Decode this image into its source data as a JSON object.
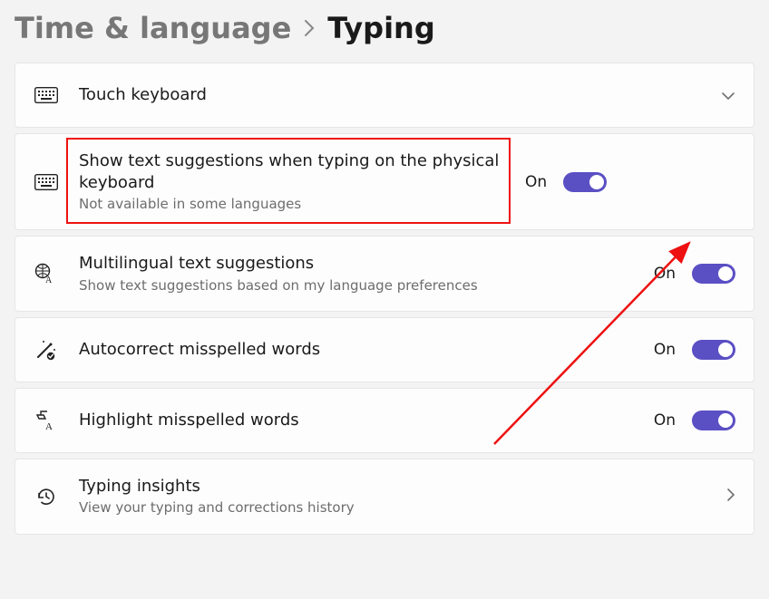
{
  "breadcrumb": {
    "parent": "Time & language",
    "current": "Typing"
  },
  "colors": {
    "accent": "#5b4fc4",
    "annotation": "#e11"
  },
  "cards": {
    "touch_keyboard": {
      "title": "Touch keyboard"
    },
    "text_suggestions": {
      "title": "Show text suggestions when typing on the physical keyboard",
      "subtitle": "Not available in some languages",
      "state": "On"
    },
    "multilingual": {
      "title": "Multilingual text suggestions",
      "subtitle": "Show text suggestions based on my language preferences",
      "state": "On"
    },
    "autocorrect": {
      "title": "Autocorrect misspelled words",
      "state": "On"
    },
    "highlight_misspelled": {
      "title": "Highlight misspelled words",
      "state": "On"
    },
    "typing_insights": {
      "title": "Typing insights",
      "subtitle": "View your typing and corrections history"
    }
  }
}
